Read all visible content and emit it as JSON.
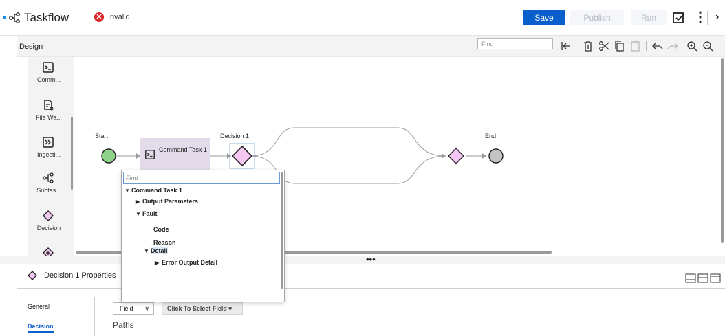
{
  "app": {
    "title": "Taskflow",
    "status": "Invalid",
    "status_color": "#d8262c"
  },
  "header": {
    "save_label": "Save",
    "publish_label": "Publish",
    "run_label": "Run",
    "accent_color": "#0a5fcc"
  },
  "design": {
    "label": "Design",
    "find_placeholder": "Find",
    "toolbar_icons": [
      "collapse-left-icon",
      "trash-icon",
      "scissors-icon",
      "copy-icon",
      "paste-icon",
      "undo-icon",
      "redo-icon",
      "zoom-in-icon",
      "zoom-out-icon"
    ]
  },
  "palette": {
    "items": [
      {
        "label": "Comm...",
        "icon": "command-icon"
      },
      {
        "label": "File Wa...",
        "icon": "file-watch-icon"
      },
      {
        "label": "Ingesti...",
        "icon": "ingestion-icon"
      },
      {
        "label": "Subtas...",
        "icon": "subtask-icon"
      },
      {
        "label": "Decision",
        "icon": "decision-icon"
      }
    ]
  },
  "diagram": {
    "start_label": "Start",
    "task_label": "Command Task 1",
    "decision_label": "Decision 1",
    "end_label": "End",
    "decision_color": "#f4c6f2",
    "start_color": "#8fd48a",
    "end_color": "#c4c4c4"
  },
  "dropdown": {
    "find_placeholder": "Find",
    "rows": {
      "root": "Command Task 1",
      "output_params": "Output Parameters",
      "fault": "Fault",
      "code": "Code",
      "reason": "Reason",
      "detail": "Detail",
      "error_output": "Error Output Detail"
    }
  },
  "properties": {
    "title": "Decision 1 Properties",
    "tabs": {
      "general": "General",
      "decision": "Decision"
    },
    "field_select": "Field",
    "field_button": "Click To Select Field ▾",
    "paths_label": "Paths"
  }
}
